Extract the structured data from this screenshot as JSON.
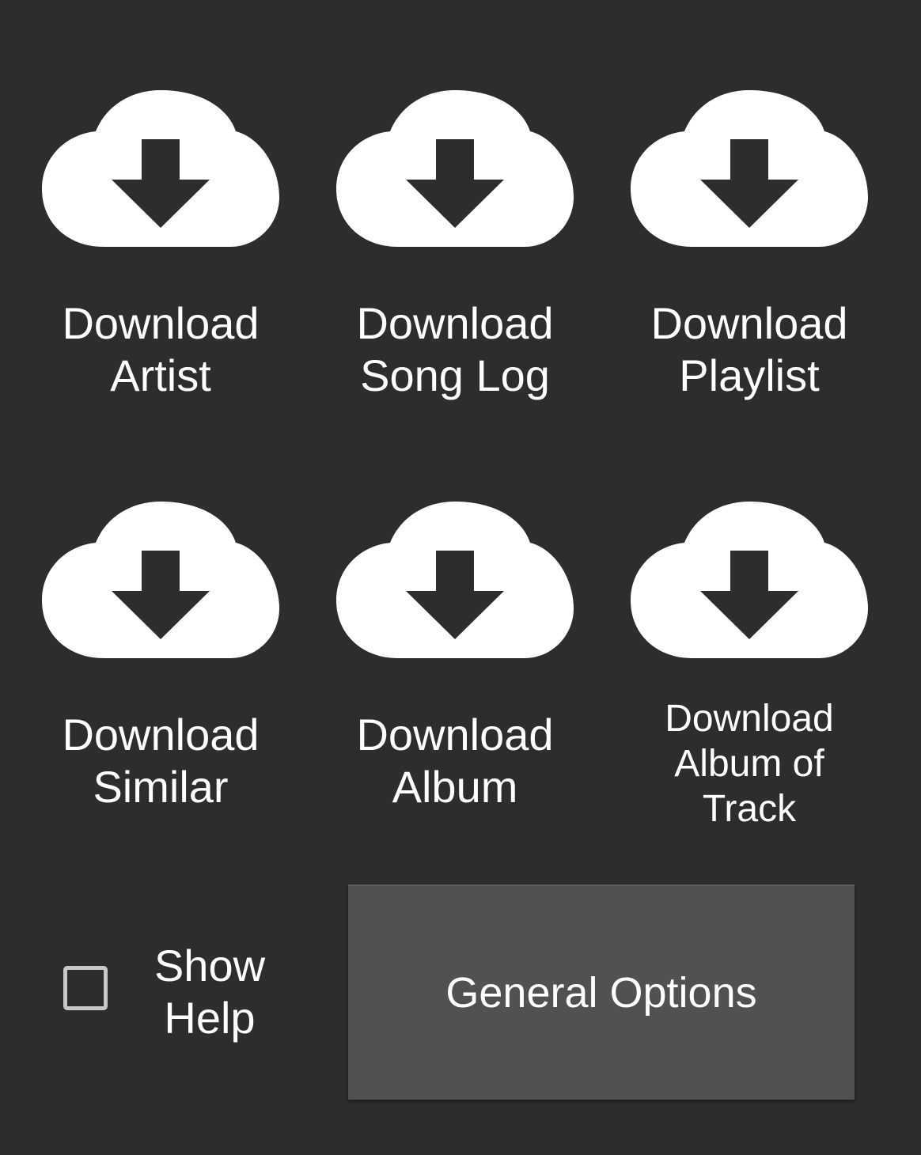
{
  "tiles": [
    {
      "label": "Download\nArtist",
      "icon": "cloud-download-icon"
    },
    {
      "label": "Download\nSong Log",
      "icon": "cloud-download-icon"
    },
    {
      "label": "Download\nPlaylist",
      "icon": "cloud-download-icon"
    },
    {
      "label": "Download\nSimilar",
      "icon": "cloud-download-icon"
    },
    {
      "label": "Download\nAlbum",
      "icon": "cloud-download-icon"
    },
    {
      "label": "Download\nAlbum of\nTrack",
      "icon": "cloud-download-icon"
    }
  ],
  "show_help": {
    "label": "Show\nHelp",
    "checked": false
  },
  "general_options": {
    "label": "General Options"
  },
  "colors": {
    "background": "#2d2d2d",
    "icon": "#ffffff",
    "button": "#515151",
    "checkbox_border": "#c9c9c9"
  }
}
